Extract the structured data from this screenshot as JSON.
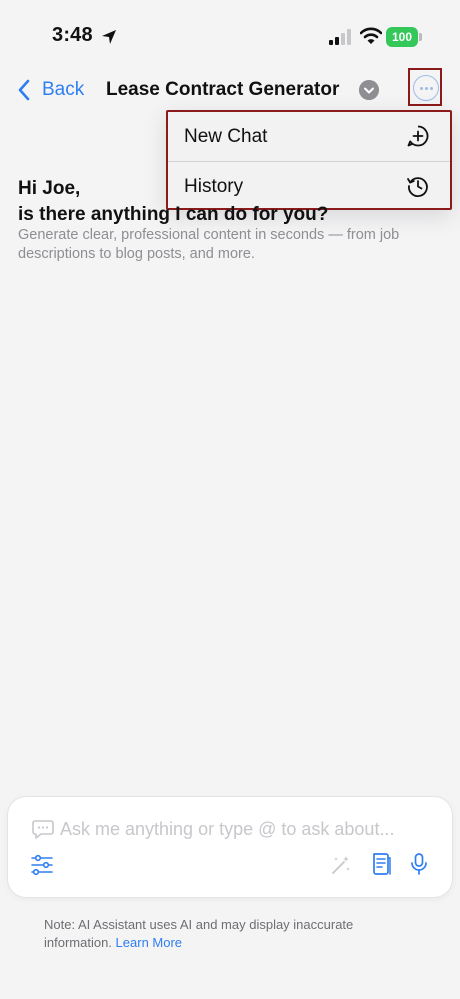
{
  "status_bar": {
    "time": "3:48",
    "battery": "100",
    "icons": [
      "location-arrow-icon",
      "cellular-signal-icon",
      "wifi-icon",
      "battery-icon"
    ]
  },
  "nav": {
    "back_label": "Back",
    "title": "Lease Contract Generator",
    "icons": [
      "chevron-left-icon",
      "chevron-down-icon",
      "more-icon"
    ]
  },
  "menu": {
    "items": [
      {
        "label": "New Chat",
        "icon": "plus-bubble-icon"
      },
      {
        "label": "History",
        "icon": "history-icon"
      }
    ]
  },
  "main": {
    "greeting_line1": "Hi Joe,",
    "greeting_line2": "is there anything I can do for you?",
    "subtitle": "Generate clear, professional content in seconds — from job descriptions to blog posts, and more."
  },
  "composer": {
    "placeholder": "Ask me anything or type @ to ask about...",
    "icons": [
      "chat-bubble-icon",
      "sliders-icon",
      "magic-wand-icon",
      "document-icon",
      "microphone-icon"
    ]
  },
  "footer": {
    "note": "Note: AI Assistant uses AI and may display inaccurate information.",
    "link": "Learn More"
  },
  "colors": {
    "accent": "#2f7ef2",
    "battery": "#34c759",
    "highlight_border": "#8b1a1a"
  }
}
